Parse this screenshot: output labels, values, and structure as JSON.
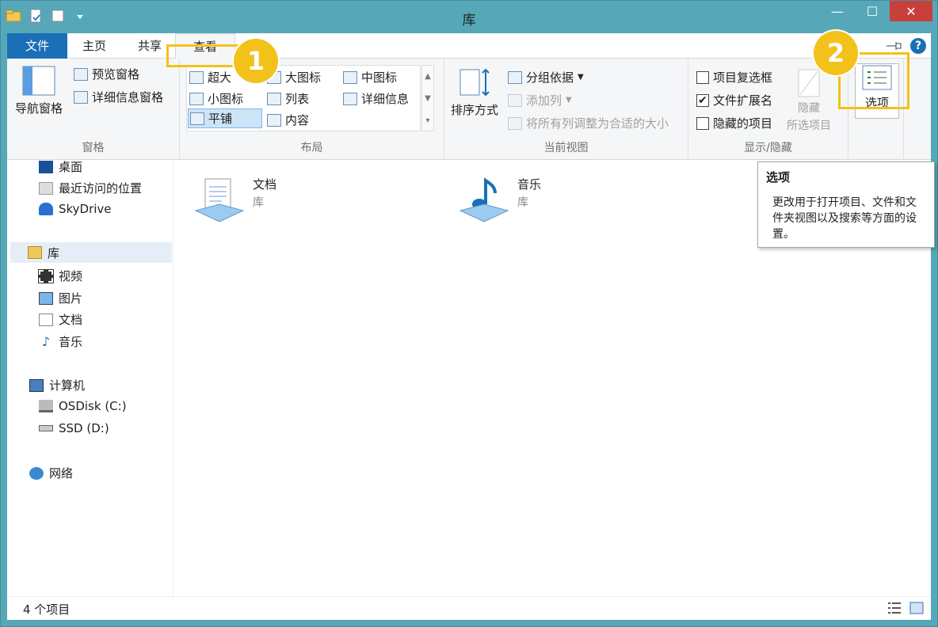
{
  "window": {
    "title": "库"
  },
  "tabs": [
    "文件",
    "主页",
    "共享",
    "查看"
  ],
  "ribbon": {
    "panes": {
      "nav_pane": "导航窗格",
      "preview_pane": "预览窗格",
      "details_pane": "详细信息窗格",
      "label": "窗格"
    },
    "layout": {
      "items": [
        "超大",
        "大图标",
        "中图标",
        "小图标",
        "列表",
        "详细信息",
        "平铺",
        "内容"
      ],
      "label": "布局"
    },
    "current_view": {
      "sort_by": "排序方式",
      "group_by": "分组依据",
      "add_columns": "添加列",
      "fit_columns": "将所有列调整为合适的大小",
      "label": "当前视图"
    },
    "show_hide": {
      "item_checkboxes": "项目复选框",
      "file_extensions": "文件扩展名",
      "hidden_items": "隐藏的项目",
      "hide_selected_1": "隐藏",
      "hide_selected_2": "所选项目",
      "label": "显示/隐藏"
    },
    "options": {
      "label": "选项"
    }
  },
  "callouts": [
    "1",
    "2"
  ],
  "tooltip": {
    "title": "选项",
    "body": "更改用于打开项目、文件和文件夹视图以及搜索等方面的设置。"
  },
  "nav": {
    "favorites": [
      "桌面",
      "最近访问的位置",
      "SkyDrive"
    ],
    "libraries": "库",
    "library_items": [
      "视频",
      "图片",
      "文档",
      "音乐"
    ],
    "computer": "计算机",
    "drives": [
      "OSDisk (C:)",
      "SSD (D:)"
    ],
    "network": "网络"
  },
  "items": [
    {
      "name": "文档",
      "sub": "库"
    },
    {
      "name": "音乐",
      "sub": "库"
    }
  ],
  "status": {
    "count": "4 个项目"
  },
  "colors": {
    "frame": "#56a8b8",
    "file_tab": "#1a6fb6",
    "highlight": "#f2c21b",
    "close": "#c9403a"
  }
}
